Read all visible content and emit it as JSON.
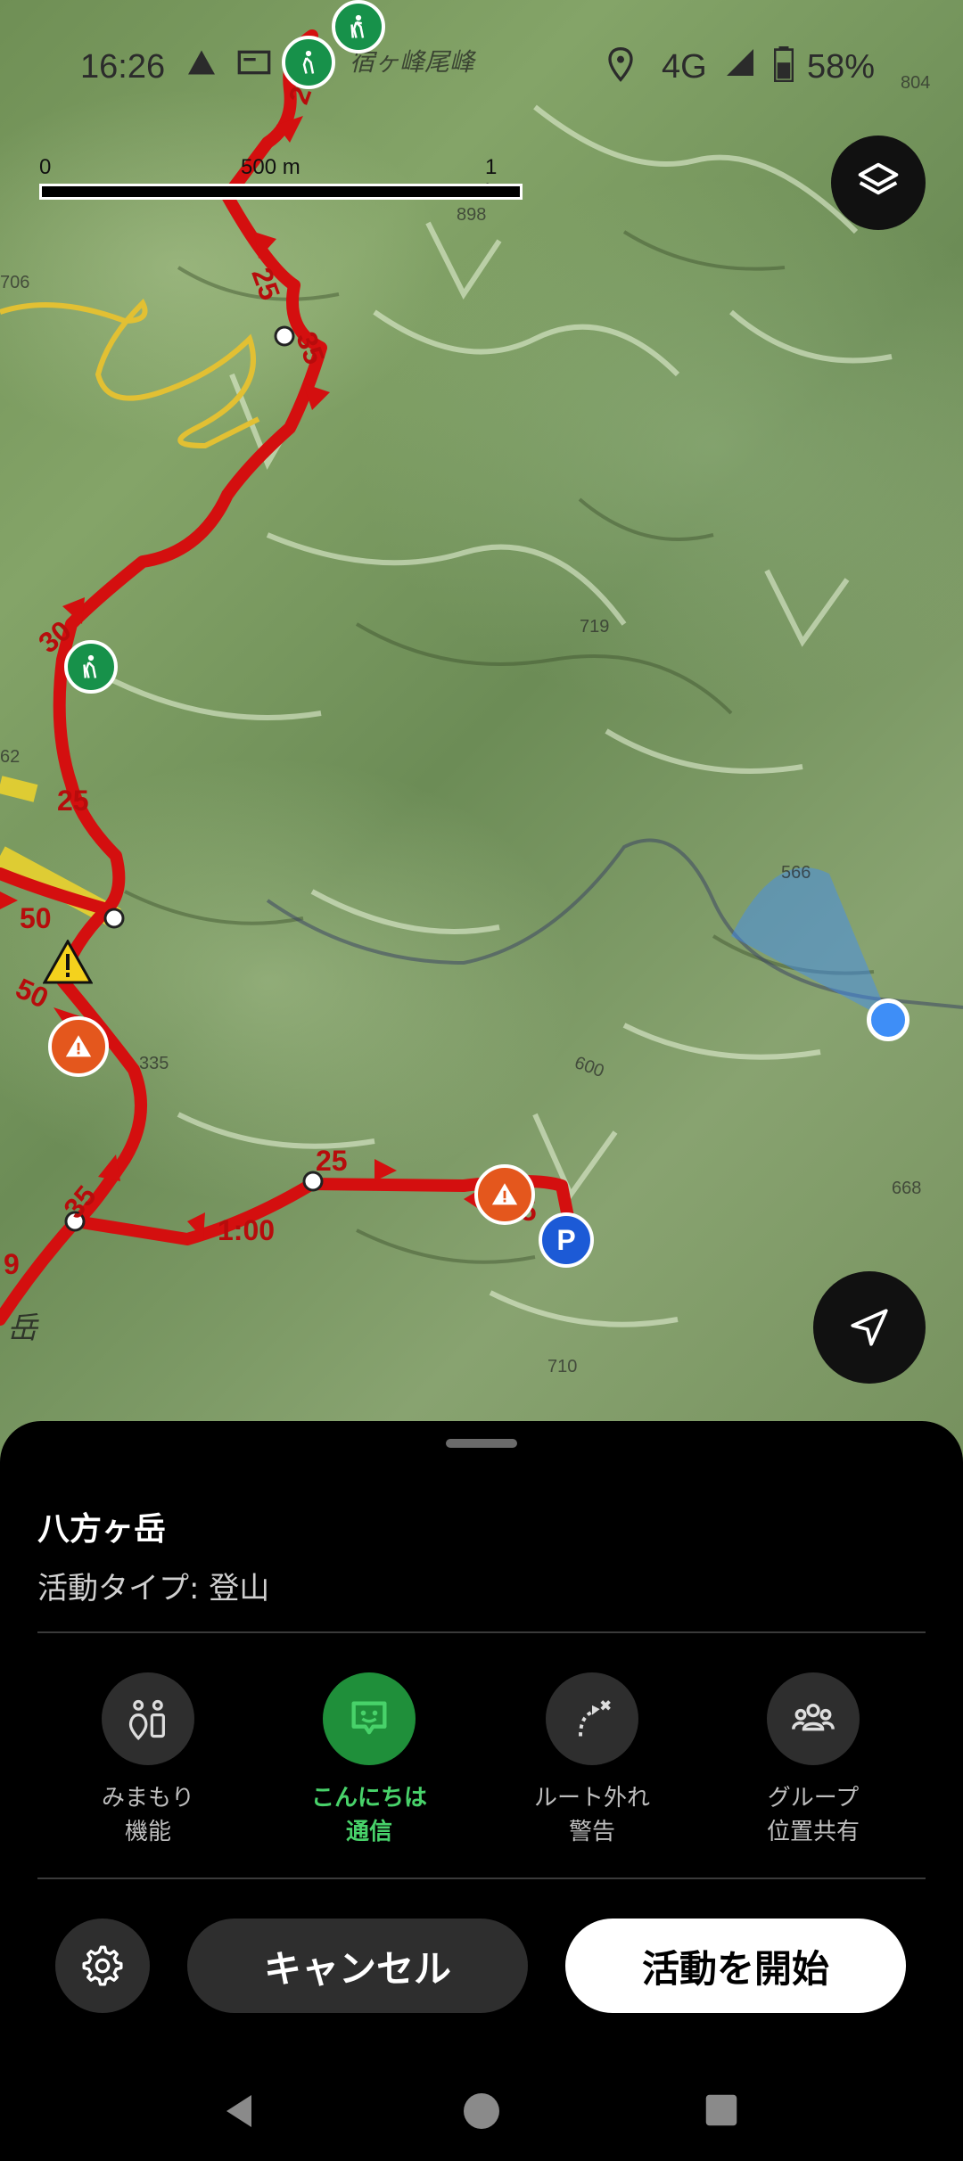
{
  "status": {
    "time": "16:26",
    "network": "4G",
    "battery": "58%"
  },
  "map": {
    "scale": {
      "zero": "0",
      "mid": "500 m",
      "end": "1 km"
    },
    "place_label": "宿ヶ峰尾峰",
    "peak_label": "岳",
    "route_numbers": [
      "20",
      "25",
      "35",
      "30",
      "25",
      "50",
      "50",
      "35",
      "25",
      "35",
      "1:00",
      "9"
    ],
    "elevations": [
      "898",
      "706",
      "719",
      "566",
      "335",
      "668",
      "710",
      "62",
      "804",
      "600"
    ],
    "route_color": "#d40f0f"
  },
  "sheet": {
    "route_name": "八方ヶ岳",
    "activity_type": "活動タイプ: 登山",
    "features": [
      {
        "icon": "watch-over-icon",
        "label": "みまもり\n機能",
        "active": false
      },
      {
        "icon": "hello-chat-icon",
        "label": "こんにちは\n通信",
        "active": true
      },
      {
        "icon": "off-route-icon",
        "label": "ルート外れ\n警告",
        "active": false
      },
      {
        "icon": "group-icon",
        "label": "グループ\n位置共有",
        "active": false
      }
    ],
    "cancel_label": "キャンセル",
    "start_label": "活動を開始",
    "accent_color": "#48d26a"
  }
}
